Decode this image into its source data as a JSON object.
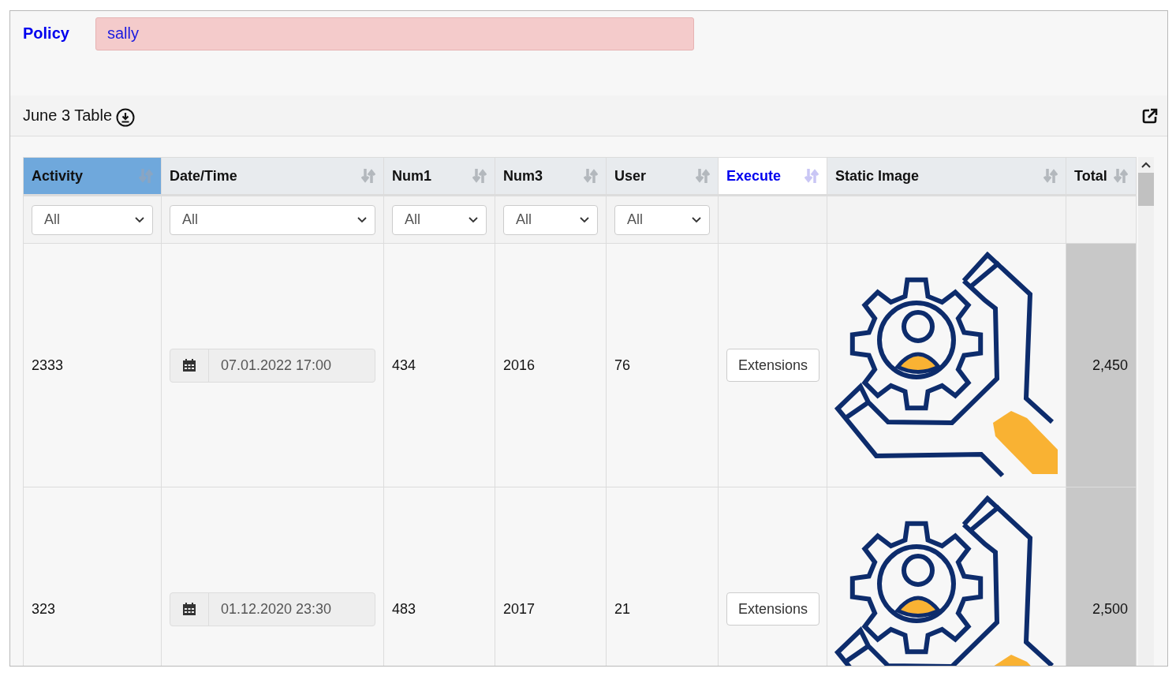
{
  "policy": {
    "label": "Policy",
    "value": "sally"
  },
  "panel": {
    "title": "June 3 Table"
  },
  "table": {
    "columns": [
      {
        "label": "Activity",
        "sorted": true,
        "highlighted": false,
        "filter": "All"
      },
      {
        "label": "Date/Time",
        "sorted": false,
        "highlighted": false,
        "filter": "All"
      },
      {
        "label": "Num1",
        "sorted": false,
        "highlighted": false,
        "filter": "All"
      },
      {
        "label": "Num3",
        "sorted": false,
        "highlighted": false,
        "filter": "All"
      },
      {
        "label": "User",
        "sorted": false,
        "highlighted": false,
        "filter": "All"
      },
      {
        "label": "Execute",
        "sorted": false,
        "highlighted": true
      },
      {
        "label": "Static Image",
        "sorted": false,
        "highlighted": false
      },
      {
        "label": "Total",
        "sorted": false,
        "highlighted": false
      }
    ],
    "rows": [
      {
        "activity": "2333",
        "datetime": "07.01.2022 17:00",
        "num1": "434",
        "num3": "2016",
        "user": "76",
        "execute": "Extensions",
        "total": "2,450"
      },
      {
        "activity": "323",
        "datetime": "01.12.2020 23:30",
        "num1": "483",
        "num3": "2017",
        "user": "21",
        "execute": "Extensions",
        "total": "2,500"
      }
    ]
  }
}
